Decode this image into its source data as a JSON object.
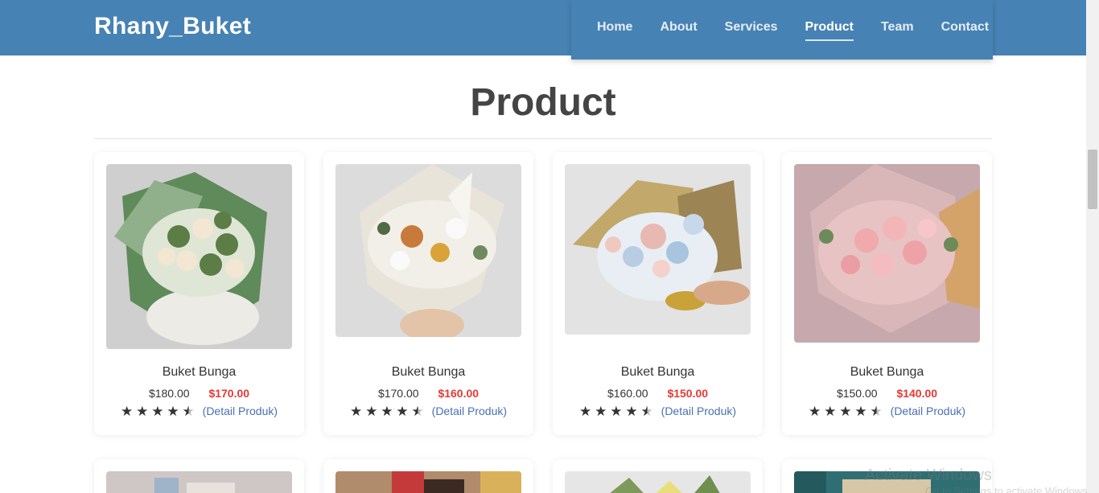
{
  "header": {
    "brand": "Rhany_Buket",
    "nav": [
      {
        "label": "Home"
      },
      {
        "label": "About"
      },
      {
        "label": "Services"
      },
      {
        "label": "Product",
        "active": true
      },
      {
        "label": "Team"
      },
      {
        "label": "Contact"
      }
    ]
  },
  "section": {
    "title": "Product"
  },
  "products": [
    {
      "name": "Buket Bunga",
      "old_price": "$180.00",
      "new_price": "$170.00",
      "rating": 4.5,
      "link_label": "(Detail Produk)"
    },
    {
      "name": "Buket Bunga",
      "old_price": "$170.00",
      "new_price": "$160.00",
      "rating": 4.5,
      "link_label": "(Detail Produk)"
    },
    {
      "name": "Buket Bunga",
      "old_price": "$160.00",
      "new_price": "$150.00",
      "rating": 4.5,
      "link_label": "(Detail Produk)"
    },
    {
      "name": "Buket Bunga",
      "old_price": "$150.00",
      "new_price": "$140.00",
      "rating": 4.5,
      "link_label": "(Detail Produk)"
    }
  ],
  "watermark": {
    "text": "Activate Windows",
    "sub": "Go to Settings to activate Windows."
  },
  "colors": {
    "navbar": "#4682b4",
    "sale_price": "#e53935",
    "link": "#4a6fb5"
  }
}
